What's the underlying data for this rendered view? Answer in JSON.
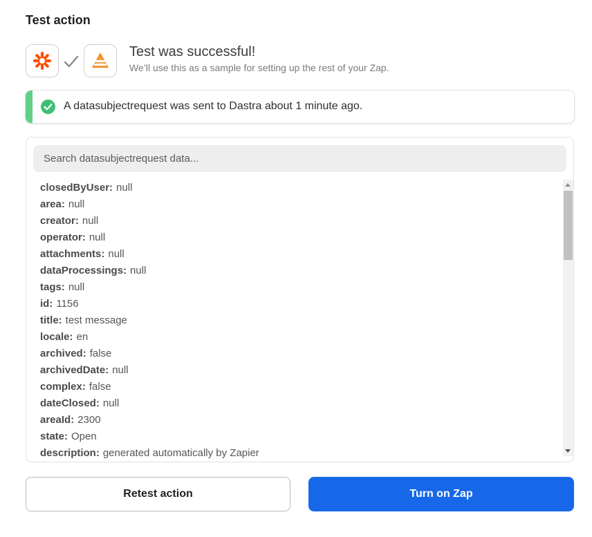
{
  "section_title": "Test action",
  "apps": {
    "trigger_icon": "zapier-asterisk-icon",
    "action_icon": "dastra-icon",
    "connector_icon": "checkmark-icon",
    "trigger_color": "#ff4f00",
    "action_color": "#f28c28"
  },
  "success": {
    "title": "Test was successful!",
    "subtitle": "We’ll use this as a sample for setting up the rest of your Zap."
  },
  "alert": {
    "text": "A datasubjectrequest was sent to Dastra about 1 minute ago.",
    "icon": "check-circle-icon",
    "accent_color": "#5fd187"
  },
  "search": {
    "placeholder": "Search datasubjectrequest data..."
  },
  "fields": [
    {
      "key": "closedByUser:",
      "value": "null"
    },
    {
      "key": "area:",
      "value": "null"
    },
    {
      "key": "creator:",
      "value": "null"
    },
    {
      "key": "operator:",
      "value": "null"
    },
    {
      "key": "attachments:",
      "value": "null"
    },
    {
      "key": "dataProcessings:",
      "value": "null"
    },
    {
      "key": "tags:",
      "value": "null"
    },
    {
      "key": "id:",
      "value": "1156"
    },
    {
      "key": "title:",
      "value": "test message"
    },
    {
      "key": "locale:",
      "value": "en"
    },
    {
      "key": "archived:",
      "value": "false"
    },
    {
      "key": "archivedDate:",
      "value": "null"
    },
    {
      "key": "complex:",
      "value": "false"
    },
    {
      "key": "dateClosed:",
      "value": "null"
    },
    {
      "key": "areaId:",
      "value": "2300"
    },
    {
      "key": "state:",
      "value": "Open"
    },
    {
      "key": "description:",
      "value": "generated automatically by Zapier"
    }
  ],
  "buttons": {
    "retest_label": "Retest action",
    "turn_on_label": "Turn on Zap",
    "primary_color": "#1668e8"
  }
}
